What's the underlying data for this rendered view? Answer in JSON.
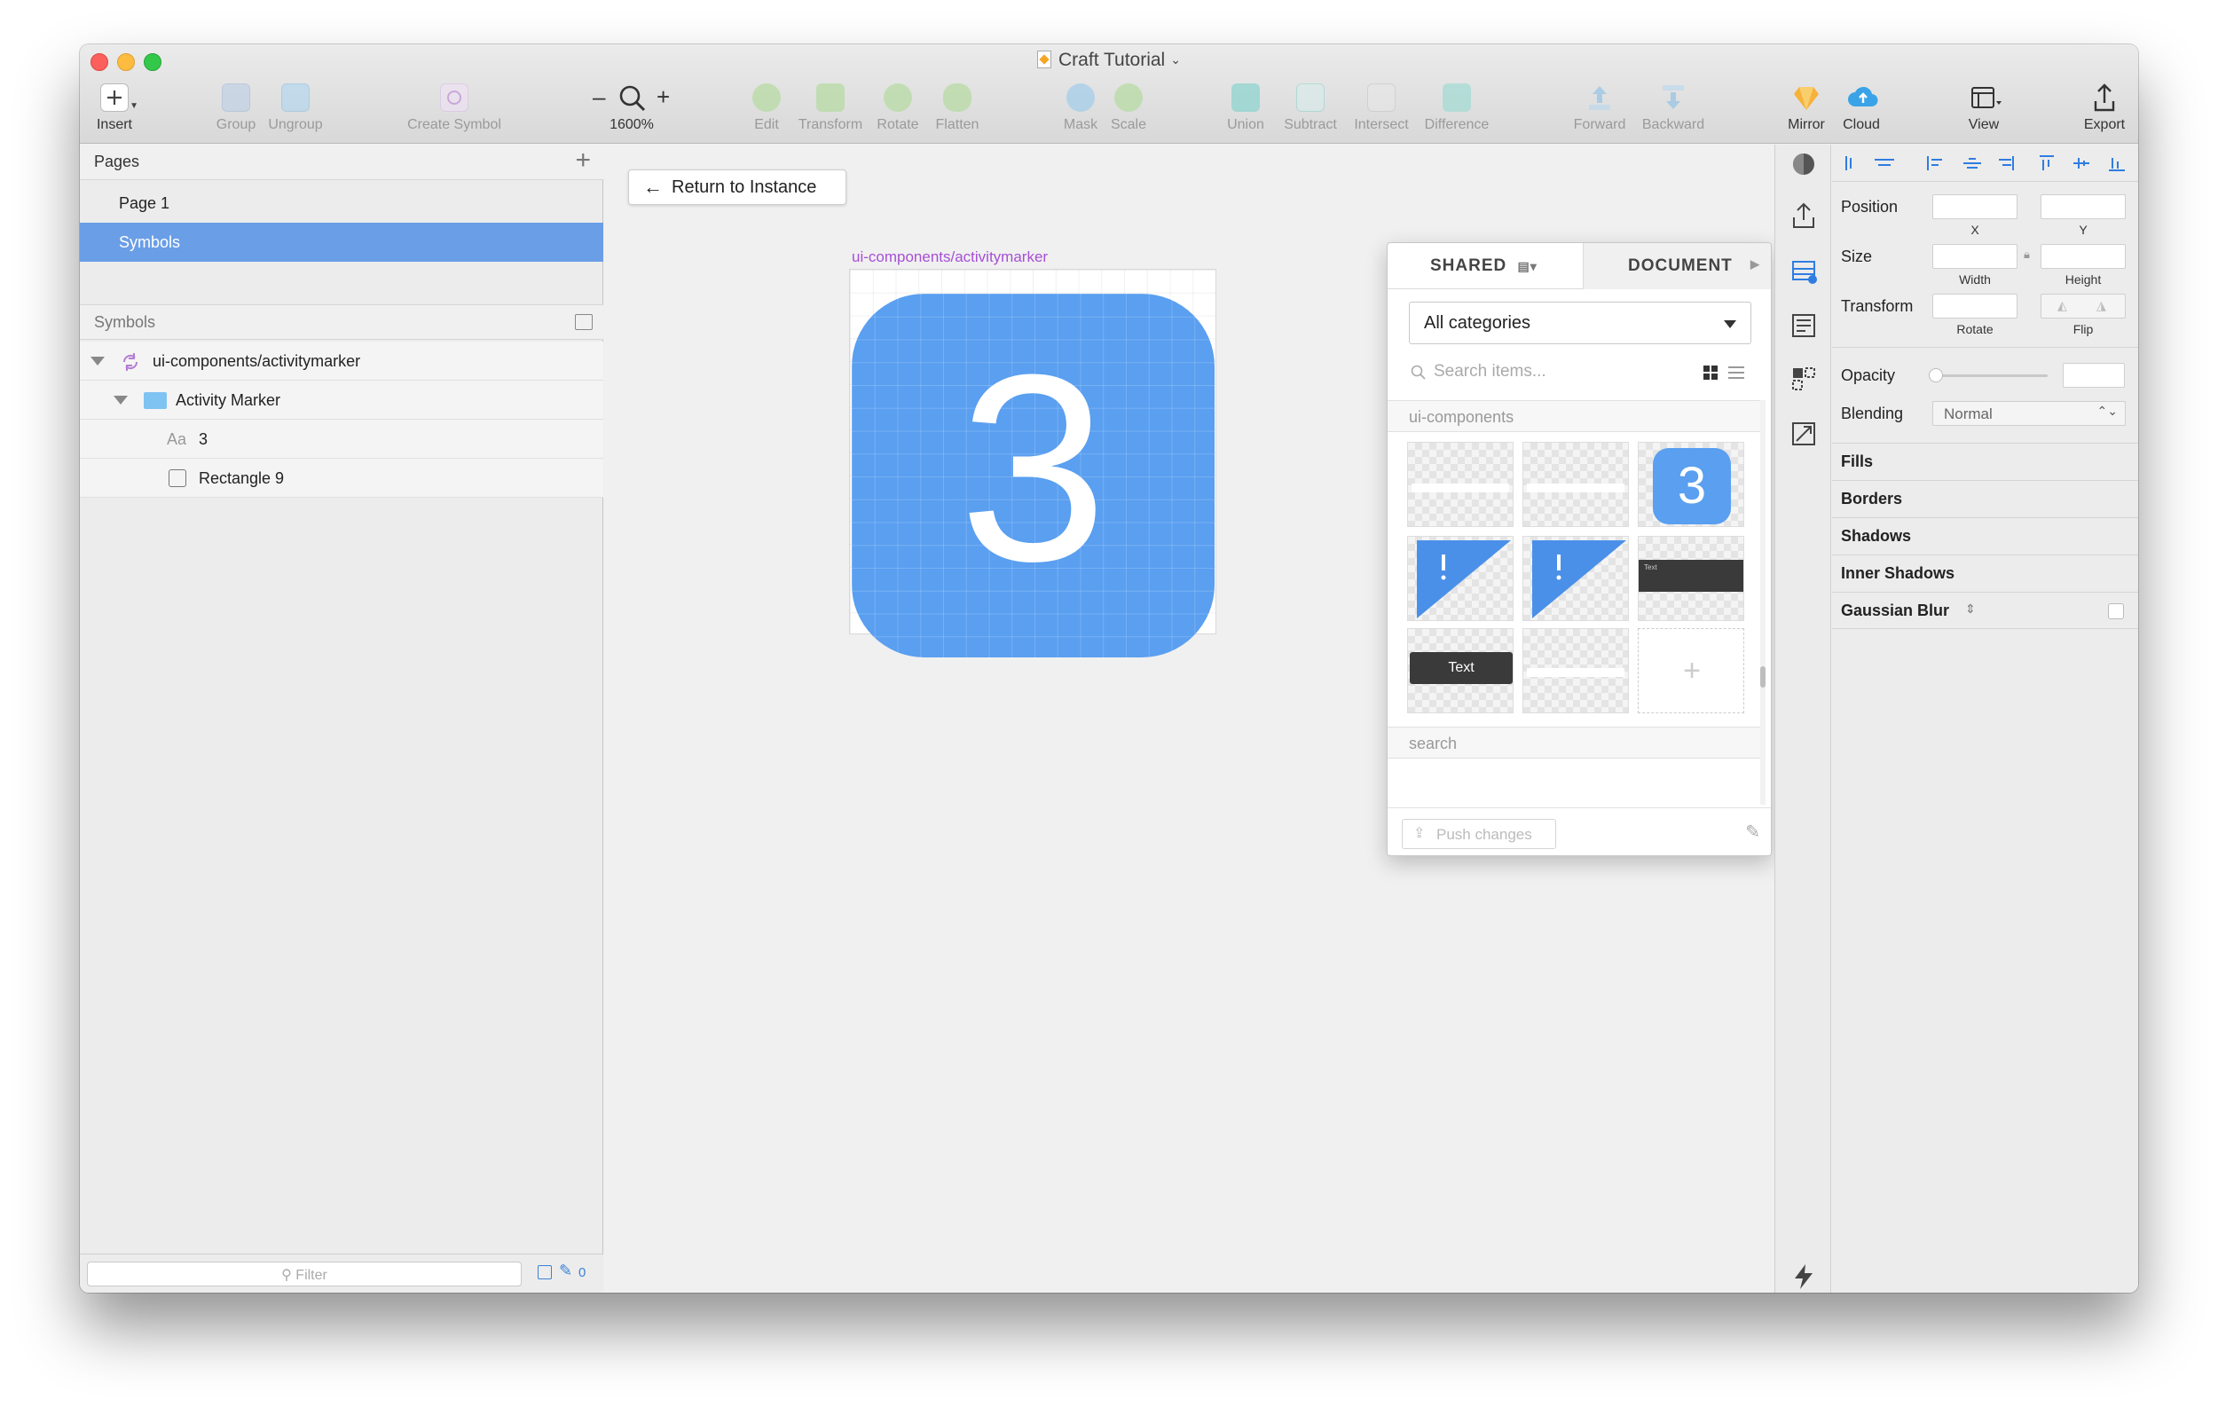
{
  "window": {
    "title": "Craft Tutorial"
  },
  "toolbar": {
    "insert": "Insert",
    "group": "Group",
    "ungroup": "Ungroup",
    "create_symbol": "Create Symbol",
    "zoom_value": "1600%",
    "zoom_minus": "–",
    "zoom_plus": "+",
    "edit": "Edit",
    "transform": "Transform",
    "rotate": "Rotate",
    "flatten": "Flatten",
    "mask": "Mask",
    "scale": "Scale",
    "union": "Union",
    "subtract": "Subtract",
    "intersect": "Intersect",
    "difference": "Difference",
    "forward": "Forward",
    "backward": "Backward",
    "mirror": "Mirror",
    "cloud": "Cloud",
    "view": "View",
    "export": "Export"
  },
  "sidebar": {
    "pages_title": "Pages",
    "pages": [
      {
        "label": "Page 1",
        "selected": false
      },
      {
        "label": "Symbols",
        "selected": true
      }
    ],
    "symbols_title": "Symbols",
    "layers": [
      {
        "label": "ui-components/activitymarker"
      },
      {
        "label": "Activity Marker"
      },
      {
        "label": "3",
        "type_prefix": "Aa"
      },
      {
        "label": "Rectangle 9"
      }
    ],
    "filter_placeholder": "Filter",
    "filter_count": "0"
  },
  "canvas": {
    "return_button": "Return to Instance",
    "artboard_label": "ui-components/activitymarker",
    "marker_number": "3",
    "marker_color": "#5a9ff0"
  },
  "library": {
    "tab_shared": "SHARED",
    "tab_document": "DOCUMENT",
    "category": "All categories",
    "search_placeholder": "Search items...",
    "section_1": "ui-components",
    "section_2": "search",
    "thumb_number": "3",
    "thumb_text": "Text",
    "thumb_small_text": "Text",
    "push_button": "Push changes"
  },
  "inspector": {
    "position": "Position",
    "x": "X",
    "y": "Y",
    "size": "Size",
    "width": "Width",
    "height": "Height",
    "transform": "Transform",
    "rotate": "Rotate",
    "flip": "Flip",
    "opacity": "Opacity",
    "blending": "Blending",
    "blending_value": "Normal",
    "fills": "Fills",
    "borders": "Borders",
    "shadows": "Shadows",
    "inner_shadows": "Inner Shadows",
    "gaussian_blur": "Gaussian Blur"
  },
  "colors": {
    "accent": "#6a9ee6",
    "symbol_purple": "#a64fd6",
    "marker_blue": "#5a9ff0"
  }
}
